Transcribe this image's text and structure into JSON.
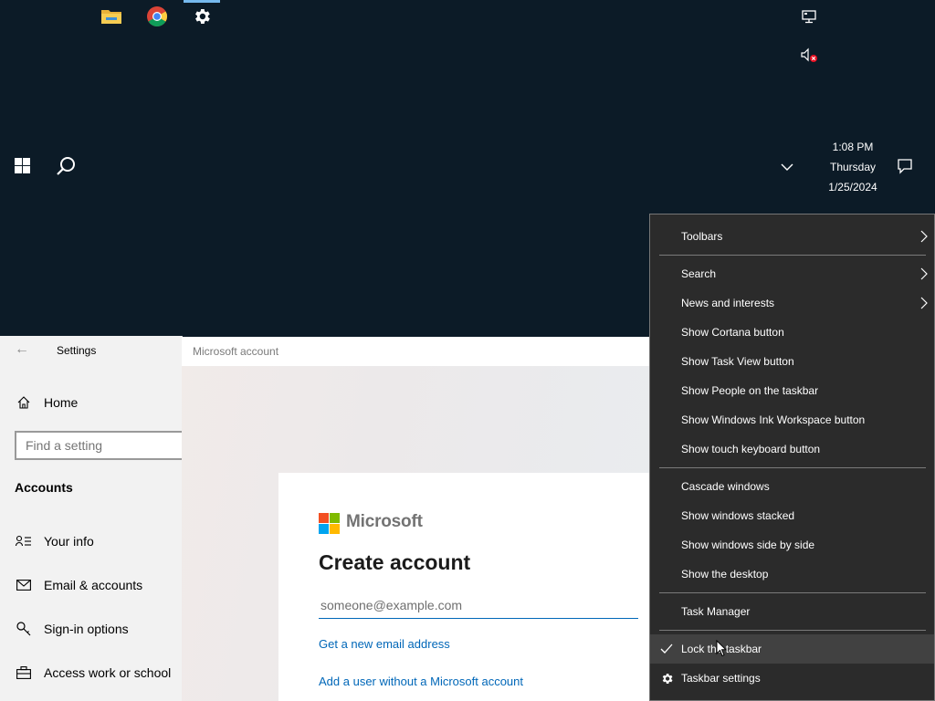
{
  "taskbar": {
    "pinned": [
      {
        "icon": "file-explorer-icon"
      },
      {
        "icon": "chrome-icon"
      },
      {
        "icon": "settings-gear-icon",
        "active": true
      }
    ],
    "tray": {
      "network_icon": "network-icon",
      "volume_icon": "volume-muted-icon",
      "chevron_icon": "chevron-down-icon",
      "notification_icon": "action-center-icon"
    },
    "clock": {
      "time": "1:08 PM",
      "day": "Thursday",
      "date": "1/25/2024"
    }
  },
  "settings_window": {
    "title": "Settings",
    "home_label": "Home",
    "search_placeholder": "Find a setting",
    "section_heading": "Accounts",
    "nav": [
      {
        "label": "Your info",
        "icon": "your-info-icon"
      },
      {
        "label": "Email & accounts",
        "icon": "mail-icon"
      },
      {
        "label": "Sign-in options",
        "icon": "key-icon"
      },
      {
        "label": "Access work or school",
        "icon": "briefcase-icon"
      }
    ]
  },
  "msa_dialog": {
    "title": "Microsoft account",
    "brand": "Microsoft",
    "brand_colors": [
      "#f25022",
      "#7fba00",
      "#00a4ef",
      "#ffb900"
    ],
    "heading": "Create account",
    "email_placeholder": "someone@example.com",
    "link_new_email": "Get a new email address",
    "link_no_msa": "Add a user without a Microsoft account"
  },
  "context_menu": {
    "items": {
      "toolbars": "Toolbars",
      "search": "Search",
      "news": "News and interests",
      "cortana": "Show Cortana button",
      "taskview": "Show Task View button",
      "people": "Show People on the taskbar",
      "ink": "Show Windows Ink Workspace button",
      "keyboard": "Show touch keyboard button",
      "cascade": "Cascade windows",
      "stacked": "Show windows stacked",
      "side": "Show windows side by side",
      "desktop": "Show the desktop",
      "taskmgr": "Task Manager",
      "lock": "Lock the taskbar",
      "tbsettings": "Taskbar settings"
    },
    "lock_checked": true
  }
}
